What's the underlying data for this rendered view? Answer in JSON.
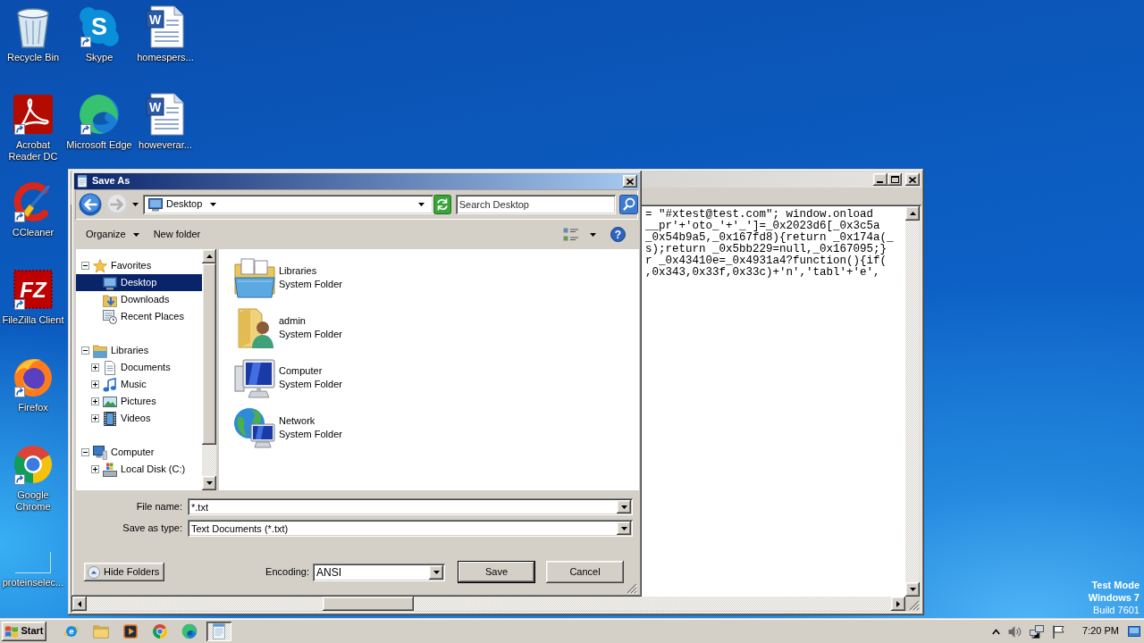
{
  "desktop": {
    "columns": [
      [
        {
          "label": "Recycle Bin",
          "kind": "trash-bin",
          "shortcut": false
        },
        {
          "label": "Acrobat Reader DC",
          "kind": "swirl-tile",
          "shortcut": true
        },
        {
          "label": "CCleaner",
          "kind": "brush-arc",
          "shortcut": true
        },
        {
          "label": "FileZilla Client",
          "kind": "letter-tile",
          "glyph": "FZ",
          "shortcut": true
        },
        {
          "label": "Firefox",
          "kind": "flame-disc",
          "shortcut": true
        },
        {
          "label": "Google Chrome",
          "kind": "segment-disc",
          "shortcut": true
        },
        {
          "label": "proteinselec...",
          "kind": "blank",
          "shortcut": false
        }
      ],
      [
        {
          "label": "Skype",
          "kind": "letter-badge",
          "glyph": "S",
          "shortcut": true
        },
        {
          "label": "Microsoft Edge",
          "kind": "wave-disc",
          "shortcut": true
        }
      ],
      [
        {
          "label": "homespers...",
          "kind": "document",
          "glyph": "W",
          "shortcut": false
        },
        {
          "label": "howeverar...",
          "kind": "document",
          "glyph": "W",
          "shortcut": false
        }
      ]
    ],
    "notice": {
      "lines": [
        "Test Mode",
        "Windows 7"
      ],
      "build": "Build 7601"
    }
  },
  "notepad": {
    "lines": [
      "= \"#xtest@test.com\"; window.onload",
      "__pr'+'oto_'+'_']=_0x2023d6[_0x3c5a",
      "_0x54b9a5,_0x167fd8){return _0x174a(_",
      "s);return _0x5bb229=null,_0x167095;}",
      "r _0x43410e=_0x4931a4?function(){if(",
      ",0x343,0x33f,0x33c)+'n','tabl'+'e',"
    ]
  },
  "save_dialog": {
    "title": "Save As",
    "history": [
      {
        "kind": "back",
        "disabled": false
      },
      {
        "kind": "forward",
        "disabled": true
      }
    ],
    "location": "Desktop",
    "search": {
      "placeholder": "Search Desktop"
    },
    "toolbar": [
      {
        "label": "Organize",
        "menu": true
      },
      {
        "label": "New folder",
        "menu": false
      }
    ],
    "help_glyph": "?",
    "tree": [
      {
        "label": "Favorites",
        "kind": "star",
        "expanded": true,
        "selected": false,
        "children": [
          {
            "label": "Desktop",
            "kind": "desktop",
            "selected": true
          },
          {
            "label": "Downloads",
            "kind": "downloads",
            "selected": false
          },
          {
            "label": "Recent Places",
            "kind": "recent",
            "selected": false
          }
        ]
      },
      {
        "label": "Libraries",
        "kind": "libraries",
        "expanded": true,
        "selected": false,
        "children": [
          {
            "label": "Documents",
            "kind": "documents",
            "expanded": false,
            "selected": false
          },
          {
            "label": "Music",
            "kind": "music",
            "expanded": false,
            "selected": false
          },
          {
            "label": "Pictures",
            "kind": "pictures",
            "expanded": false,
            "selected": false
          },
          {
            "label": "Videos",
            "kind": "videos",
            "expanded": false,
            "selected": false
          }
        ]
      },
      {
        "label": "Computer",
        "kind": "computer",
        "expanded": true,
        "selected": false,
        "children": [
          {
            "label": "Local Disk (C:)",
            "kind": "disk",
            "expanded": false,
            "selected": false
          }
        ]
      }
    ],
    "items": [
      {
        "label": "Libraries",
        "description": "System Folder",
        "kind": "libraries"
      },
      {
        "label": "admin",
        "description": "System Folder",
        "kind": "user-folder"
      },
      {
        "label": "Computer",
        "description": "System Folder",
        "kind": "computer"
      },
      {
        "label": "Network",
        "description": "System Folder",
        "kind": "network"
      }
    ],
    "file_name": {
      "label": "File name:",
      "value": "*.txt"
    },
    "save_as_type": {
      "label": "Save as type:",
      "value": "Text Documents (*.txt)"
    },
    "hide_folders": "Hide Folders",
    "encoding": {
      "label": "Encoding:",
      "value": "ANSI"
    },
    "buttons": [
      {
        "label": "Save",
        "default": true
      },
      {
        "label": "Cancel",
        "default": false
      }
    ]
  },
  "taskbar": {
    "start": "Start",
    "buttons": [
      {
        "kind": "e-globe",
        "glyph": "e",
        "selected": false
      },
      {
        "kind": "folder",
        "selected": false
      },
      {
        "kind": "play-tile",
        "selected": false
      },
      {
        "kind": "segment-disc",
        "selected": false
      },
      {
        "kind": "wave-disc",
        "selected": false
      },
      {
        "kind": "notepad",
        "selected": true
      }
    ],
    "time": "7:20 PM"
  }
}
